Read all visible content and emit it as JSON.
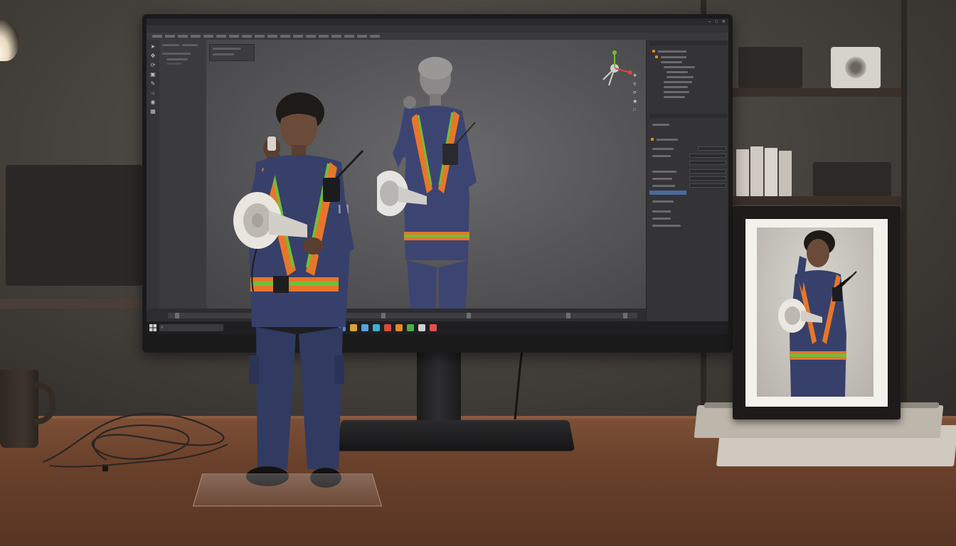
{
  "scene": {
    "description_hidden": "",
    "colors": {
      "uniform": "#37406a",
      "vest_orange": "#e8762a",
      "vest_green": "#6fbf3a",
      "skin": "#6a4a38",
      "desk_wood": "#6a412b",
      "screen_bg": "#4b4b4d",
      "accent_selection": "#4a6a9a"
    }
  },
  "software_window": {
    "icons": {
      "minimize": "minimize-icon",
      "maximize": "maximize-icon",
      "close": "close-icon"
    },
    "left_tools": [
      "select-icon",
      "move-icon",
      "rotate-icon",
      "scale-icon",
      "brush-icon",
      "light-icon",
      "camera-icon",
      "grid-icon"
    ],
    "viewport": {
      "gizmo": "axis-gizmo-icon",
      "nav_icons": [
        "pan-icon",
        "zoom-icon",
        "orbit-icon",
        "camera-view-icon",
        "frame-icon"
      ]
    }
  },
  "taskbar": {
    "app_icon_colors": [
      "#4a8ad8",
      "#d8a23a",
      "#5aa0e0",
      "#3ab0d0",
      "#d84a3a",
      "#e08a2a",
      "#4ab04a",
      "#d0d0d0",
      "#e05050"
    ]
  }
}
